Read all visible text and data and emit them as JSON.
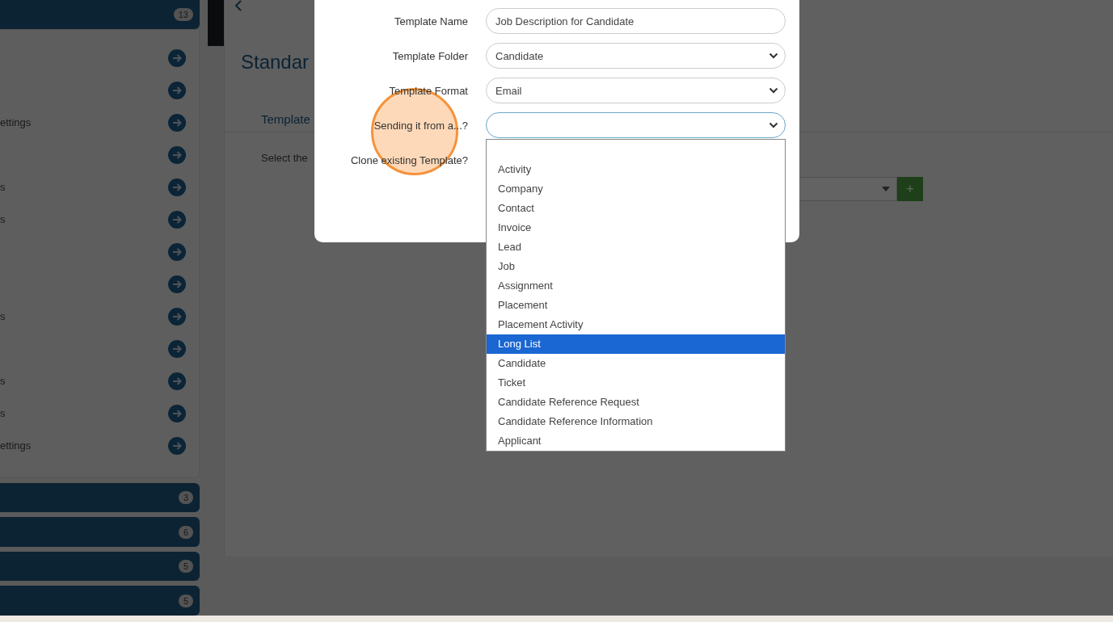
{
  "sidebar": {
    "top_group": {
      "badge": "13",
      "items": [
        {
          "kind": "plain"
        },
        {
          "kind": "plain"
        },
        {
          "kind": "labeled",
          "label": "ettings"
        },
        {
          "kind": "plain"
        },
        {
          "kind": "labeled",
          "label": "s"
        },
        {
          "kind": "labeled",
          "label": "s"
        },
        {
          "kind": "plain"
        },
        {
          "kind": "plain"
        },
        {
          "kind": "labeled",
          "label": "s"
        },
        {
          "kind": "plain"
        },
        {
          "kind": "labeled",
          "label": "s"
        },
        {
          "kind": "labeled",
          "label": "s"
        },
        {
          "kind": "labeled",
          "label": "ettings"
        }
      ]
    },
    "groups": [
      {
        "badge": "3"
      },
      {
        "badge": "6"
      },
      {
        "badge": "5"
      },
      {
        "badge": "5"
      }
    ]
  },
  "main": {
    "title": "Standar",
    "tab": "Template",
    "prompt": "Select the",
    "add_button": "+"
  },
  "modal": {
    "fields": [
      {
        "label": "Template Name",
        "kind": "text",
        "value": "Job Description for Candidate"
      },
      {
        "label": "Template Folder",
        "kind": "select",
        "value": "Candidate"
      },
      {
        "label": "Template Format",
        "kind": "select",
        "value": "Email"
      },
      {
        "label": "Sending it from a...?",
        "kind": "select",
        "focused": true
      },
      {
        "label": "Clone existing Template?",
        "kind": "none"
      }
    ],
    "dropdown": [
      {
        "label": "Activity",
        "selected": false
      },
      {
        "label": "Company",
        "selected": false
      },
      {
        "label": "Contact",
        "selected": false
      },
      {
        "label": "Invoice",
        "selected": false
      },
      {
        "label": "Lead",
        "selected": false
      },
      {
        "label": "Job",
        "selected": false
      },
      {
        "label": "Assignment",
        "selected": false
      },
      {
        "label": "Placement",
        "selected": false
      },
      {
        "label": "Placement Activity",
        "selected": false
      },
      {
        "label": "Long List",
        "selected": true
      },
      {
        "label": "Candidate",
        "selected": false
      },
      {
        "label": "Ticket",
        "selected": false
      },
      {
        "label": "Candidate Reference Request",
        "selected": false
      },
      {
        "label": "Candidate Reference Information",
        "selected": false
      },
      {
        "label": "Applicant",
        "selected": false
      }
    ]
  }
}
